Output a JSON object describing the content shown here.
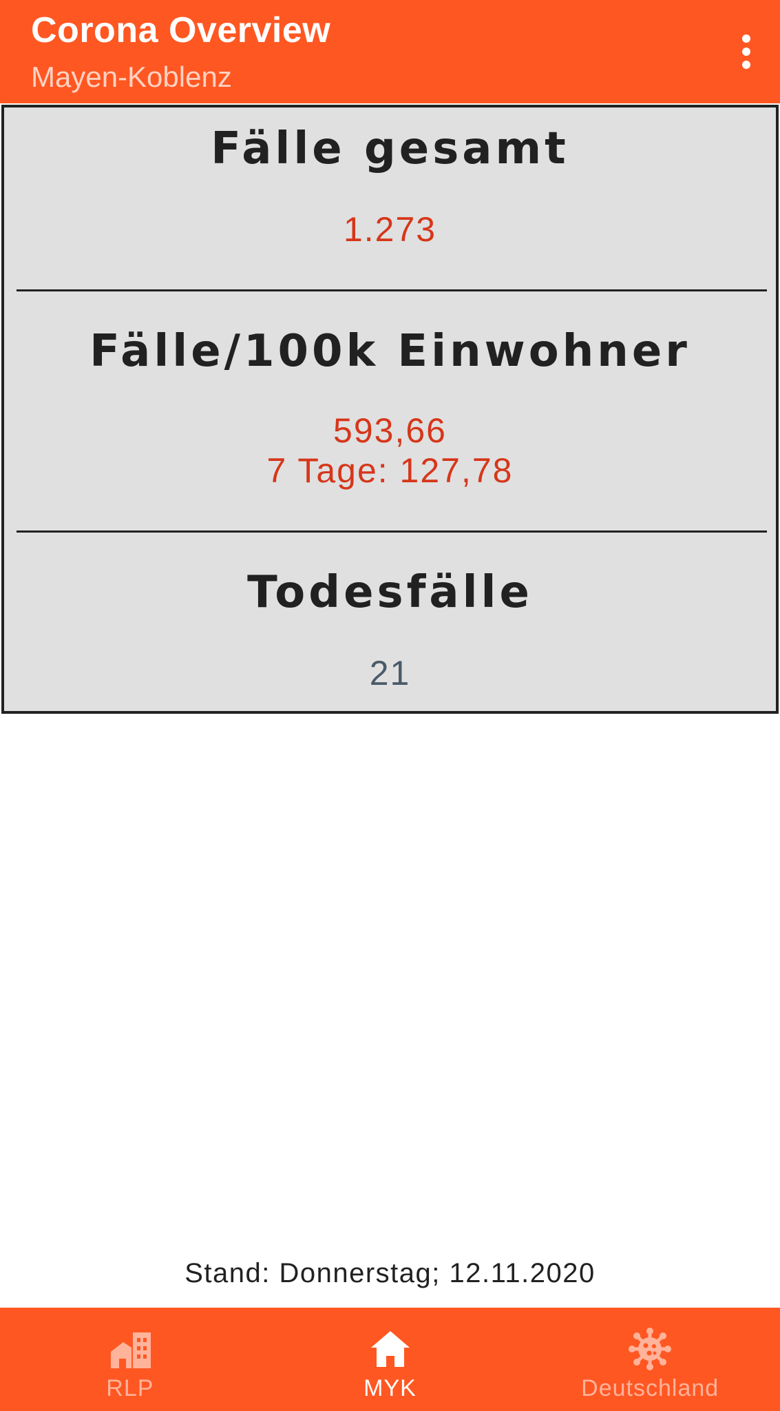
{
  "app_bar": {
    "title": "Corona Overview",
    "subtitle": "Mayen-Koblenz",
    "menu_icon": "more-vert-icon"
  },
  "stats": {
    "cases_total": {
      "heading": "Fälle gesamt",
      "value": "1.273"
    },
    "cases_per_100k": {
      "heading": "Fälle/100k Einwohner",
      "value": "593,66",
      "seven_day": "7 Tage: 127,78"
    },
    "deaths": {
      "heading": "Todesfälle",
      "value": "21"
    }
  },
  "footer": {
    "stand": "Stand: Donnerstag; 12.11.2020"
  },
  "bottom_nav": {
    "items": [
      {
        "label": "RLP",
        "icon": "city-buildings-icon",
        "active": false
      },
      {
        "label": "MYK",
        "icon": "home-icon",
        "active": true
      },
      {
        "label": "Deutschland",
        "icon": "virus-icon",
        "active": false
      }
    ]
  },
  "colors": {
    "primary": "#FF5722",
    "value_red": "#D6361A",
    "value_gray": "#4A5A68",
    "card_bg": "#E0E0E0"
  }
}
